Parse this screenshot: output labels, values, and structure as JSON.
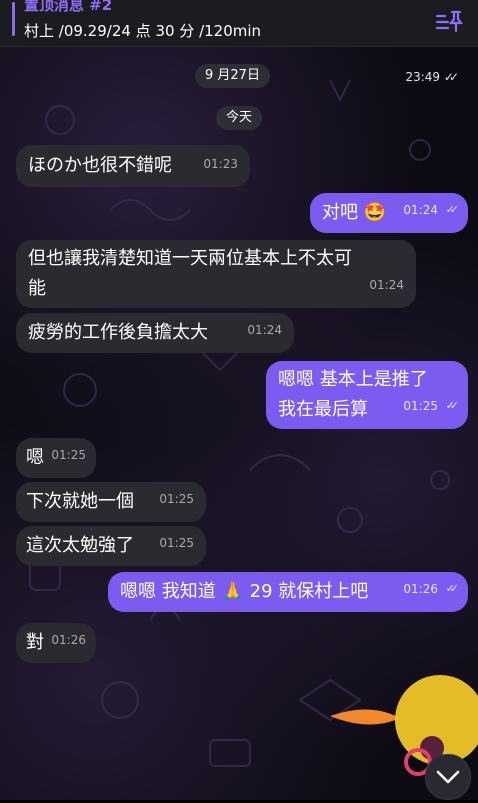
{
  "pinned": {
    "title": "置顶消息 #2",
    "text": "村上 /09.29/24 点 30 分 /120min"
  },
  "date_label": "9 月27日",
  "top_time": "23:49",
  "today_label": "今天",
  "messages": [
    {
      "dir": "in",
      "text": "ほのか也很不錯呢",
      "time": "01:23"
    },
    {
      "dir": "out",
      "text": "对吧",
      "emoji": "🤩",
      "time": "01:24"
    },
    {
      "dir": "in",
      "line1": "但也讓我清楚知道一天兩位基本上不太可",
      "line2": "能",
      "time": "01:24"
    },
    {
      "dir": "in",
      "text": "疲勞的工作後負擔太大",
      "time": "01:24"
    },
    {
      "dir": "out",
      "line1": "嗯嗯 基本上是推了",
      "line2": "我在最后算",
      "time": "01:25"
    },
    {
      "dir": "in",
      "text": "嗯",
      "time": "01:25"
    },
    {
      "dir": "in",
      "text": "下次就她一個",
      "time": "01:25"
    },
    {
      "dir": "in",
      "text": "這次太勉強了",
      "time": "01:25"
    },
    {
      "dir": "out",
      "text_a": "嗯嗯 我知道",
      "emoji": "🙏",
      "text_b": "29 就保村上吧",
      "time": "01:26"
    },
    {
      "dir": "in",
      "text": "對",
      "time": "01:26"
    }
  ],
  "colors": {
    "accent": "#7c5cf0",
    "incoming": "#2c2a31",
    "pinned_bg": "#1c1b1f"
  },
  "icons": [
    "pin-list-icon",
    "double-check-icon",
    "chevron-down-icon"
  ]
}
